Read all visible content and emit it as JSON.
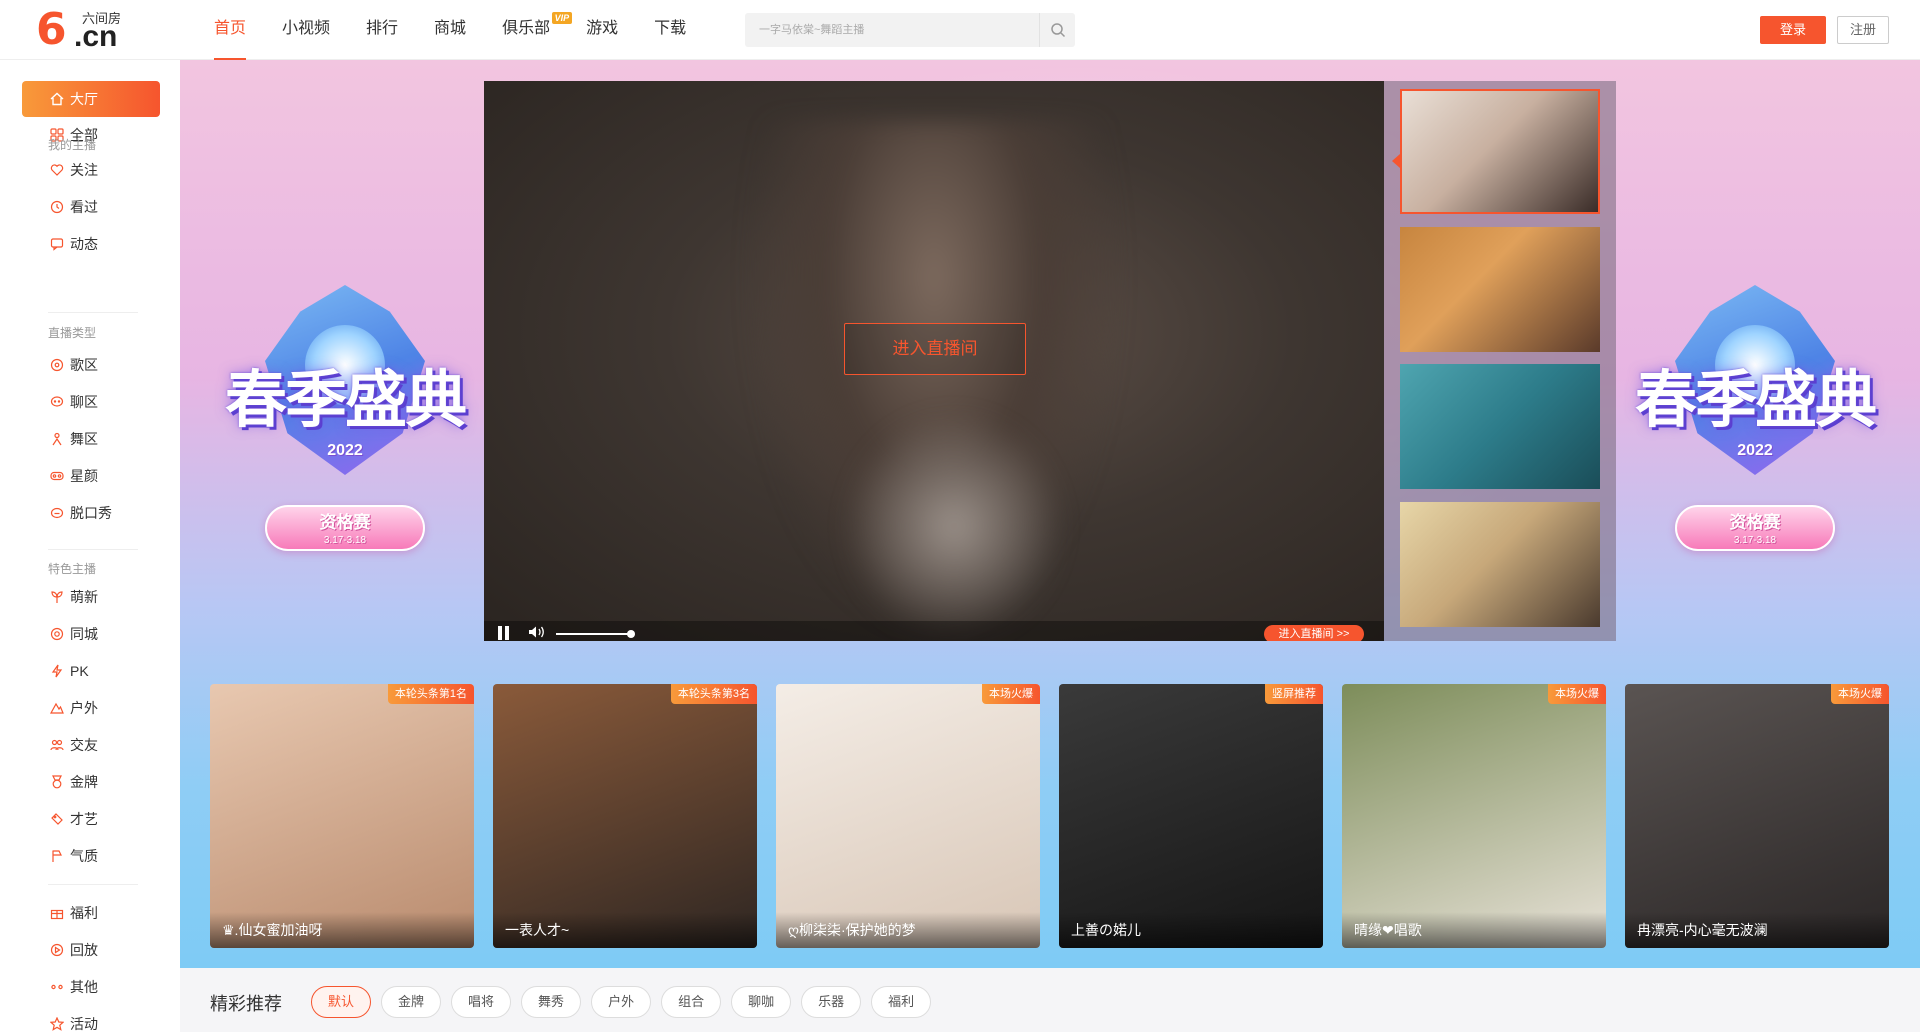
{
  "header": {
    "logo_brand": "六间房",
    "logo_mark": "6",
    "logo_domain": ".cn",
    "nav": [
      {
        "label": "首页",
        "active": true
      },
      {
        "label": "小视频"
      },
      {
        "label": "排行"
      },
      {
        "label": "商城"
      },
      {
        "label": "俱乐部",
        "badge": "VIP"
      },
      {
        "label": "游戏"
      },
      {
        "label": "下载"
      }
    ],
    "search_placeholder": "一字马依棠~舞蹈主播",
    "login": "登录",
    "register": "注册"
  },
  "sidebar": {
    "items_top": [
      {
        "label": "大厅",
        "icon": "home-icon",
        "active": true
      },
      {
        "label": "全部",
        "icon": "grid-icon"
      }
    ],
    "section_mine": "我的主播",
    "items_mine": [
      {
        "label": "关注",
        "icon": "heart-icon"
      },
      {
        "label": "看过",
        "icon": "clock-icon"
      },
      {
        "label": "动态",
        "icon": "message-icon"
      }
    ],
    "section_type": "直播类型",
    "items_type": [
      {
        "label": "歌区",
        "icon": "music-icon"
      },
      {
        "label": "聊区",
        "icon": "chat-icon"
      },
      {
        "label": "舞区",
        "icon": "dancer-icon"
      },
      {
        "label": "星颜",
        "icon": "mask-icon"
      },
      {
        "label": "脱口秀",
        "icon": "mic-icon"
      }
    ],
    "section_feature": "特色主播",
    "items_feature": [
      {
        "label": "萌新",
        "icon": "sprout-icon"
      },
      {
        "label": "同城",
        "icon": "location-icon"
      },
      {
        "label": "PK",
        "icon": "lightning-icon"
      },
      {
        "label": "户外",
        "icon": "mountain-icon"
      },
      {
        "label": "交友",
        "icon": "users-icon"
      },
      {
        "label": "金牌",
        "icon": "medal-icon"
      },
      {
        "label": "才艺",
        "icon": "palette-icon"
      },
      {
        "label": "气质",
        "icon": "flag-icon"
      }
    ],
    "items_bottom": [
      {
        "label": "福利",
        "icon": "gift-icon"
      },
      {
        "label": "回放",
        "icon": "replay-icon"
      },
      {
        "label": "其他",
        "icon": "more-icon"
      },
      {
        "label": "活动",
        "icon": "star-icon"
      }
    ]
  },
  "hero": {
    "event_title": "春季盛典",
    "event_year": "2022",
    "event_stage": "资格赛",
    "event_dates": "3.17-3.18",
    "enter_room": "进入直播间",
    "enter_room_small": "进入直播间 >>"
  },
  "cards": [
    {
      "badge": "本轮头条第1名",
      "caption": "♛.仙女蜜加油呀",
      "tone": [
        "#e8c8b0",
        "#b98b6e"
      ]
    },
    {
      "badge": "本轮头条第3名",
      "caption": "一表人才~",
      "tone": [
        "#8a5a3a",
        "#2e2622"
      ]
    },
    {
      "badge": "本场火爆",
      "caption": "ღ柳柒柒·保护她的梦",
      "tone": [
        "#f4ede6",
        "#d8c6b6"
      ]
    },
    {
      "badge": "竖屏推荐",
      "caption": "上善の婼儿",
      "tone": [
        "#3a3a3a",
        "#151515"
      ]
    },
    {
      "badge": "本场火爆",
      "caption": "晴缘❤唱歌",
      "tone": [
        "#7d8d5a",
        "#e8e2d8"
      ]
    },
    {
      "badge": "本场火爆",
      "caption": "冉漂亮-内心毫无波澜",
      "tone": [
        "#5a5452",
        "#2a2626"
      ]
    }
  ],
  "recommend": {
    "title": "精彩推荐",
    "tags": [
      {
        "label": "默认",
        "active": true
      },
      {
        "label": "金牌"
      },
      {
        "label": "唱将"
      },
      {
        "label": "舞秀"
      },
      {
        "label": "户外"
      },
      {
        "label": "组合"
      },
      {
        "label": "聊咖"
      },
      {
        "label": "乐器"
      },
      {
        "label": "福利"
      }
    ]
  },
  "colors": {
    "accent": "#f6552e",
    "accent_light": "#f89a3a"
  }
}
